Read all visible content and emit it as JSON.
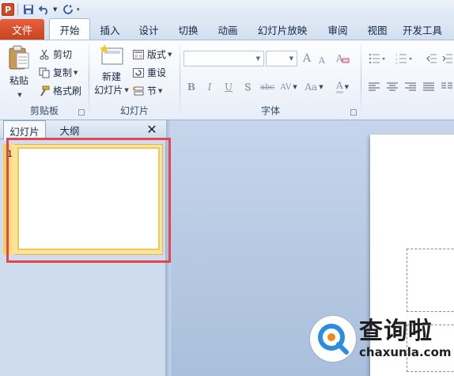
{
  "quick_access": {
    "logo": "P",
    "icons": [
      "save-icon",
      "undo-icon",
      "redo-icon",
      "customize-icon"
    ]
  },
  "tabs": {
    "file": "文件",
    "items": [
      "开始",
      "插入",
      "设计",
      "切换",
      "动画",
      "幻灯片放映",
      "审阅",
      "视图",
      "开发工具"
    ],
    "active": "开始"
  },
  "ribbon": {
    "clipboard": {
      "paste": "粘贴",
      "cut": "剪切",
      "copy": "复制",
      "format_painter": "格式刷",
      "group_label": "剪贴板"
    },
    "slides": {
      "new_slide_line1": "新建",
      "new_slide_line2": "幻灯片",
      "layout": "版式",
      "reset": "重设",
      "section": "节",
      "group_label": "幻灯片"
    },
    "font": {
      "grow": "A",
      "shrink": "A",
      "bold": "B",
      "italic": "I",
      "underline": "U",
      "shadow": "S",
      "strikethrough": "abc",
      "spacing": "AV",
      "case": "Aa",
      "color": "A",
      "group_label": "字体"
    }
  },
  "left_pane": {
    "tab_slides": "幻灯片",
    "tab_outline": "大纲",
    "close": "✕",
    "slide_number": "1"
  },
  "watermark": {
    "cn": "查询啦",
    "en": "chaxunla.com"
  },
  "colors": {
    "file_tab": "#d24726",
    "highlight": "#e4464b",
    "thumb_selected": "#fbe49a",
    "watermark_blue": "#2a8de0",
    "watermark_orange": "#f08a1c"
  }
}
